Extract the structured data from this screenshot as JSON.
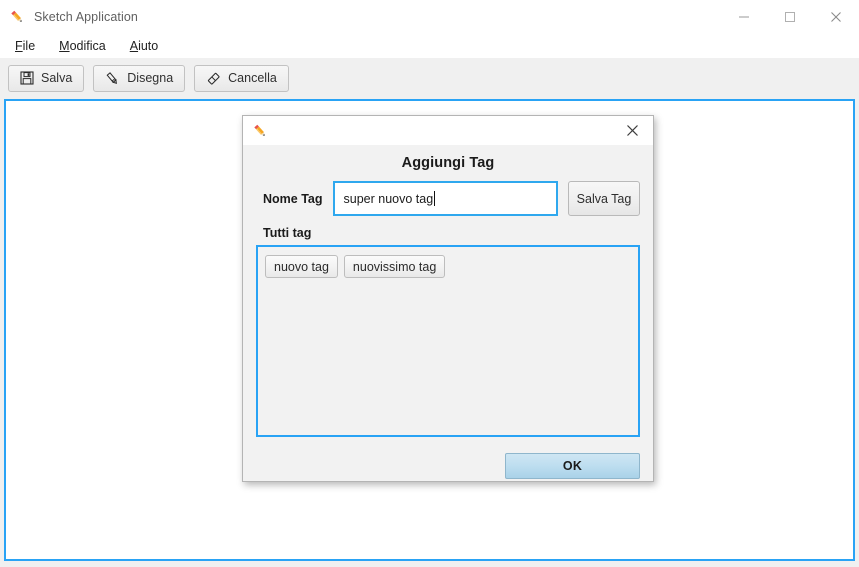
{
  "window": {
    "title": "Sketch Application",
    "icon": "pencil-icon",
    "controls": {
      "minimize": "minimize-icon",
      "maximize": "maximize-icon",
      "close": "close-icon"
    }
  },
  "menu": {
    "items": [
      {
        "label": "File",
        "mnemonic": "F",
        "rest": "ile"
      },
      {
        "label": "Modifica",
        "mnemonic": "M",
        "rest": "odifica"
      },
      {
        "label": "Aiuto",
        "mnemonic": "A",
        "rest": "iuto"
      }
    ]
  },
  "toolbar": {
    "buttons": [
      {
        "label": "Salva",
        "icon": "floppy-disk-icon"
      },
      {
        "label": "Disegna",
        "icon": "pencil-icon"
      },
      {
        "label": "Cancella",
        "icon": "eraser-icon"
      }
    ]
  },
  "dialog": {
    "icon": "pencil-icon",
    "close_icon": "close-icon",
    "heading": "Aggiungi Tag",
    "tag_name_label": "Nome Tag",
    "tag_name_value": "super nuovo tag",
    "tag_name_placeholder": "",
    "save_tag_label": "Salva Tag",
    "all_tags_label": "Tutti tag",
    "tags": [
      {
        "label": "nuovo tag"
      },
      {
        "label": "nuovissimo tag"
      }
    ],
    "ok_label": "OK"
  },
  "colors": {
    "canvas_border": "#29a3f5",
    "input_focus_border": "#2fa8ee",
    "ok_button": "#bedef0",
    "window_background": "#f0f0f0",
    "dialog_background": "#f2f2f2"
  }
}
